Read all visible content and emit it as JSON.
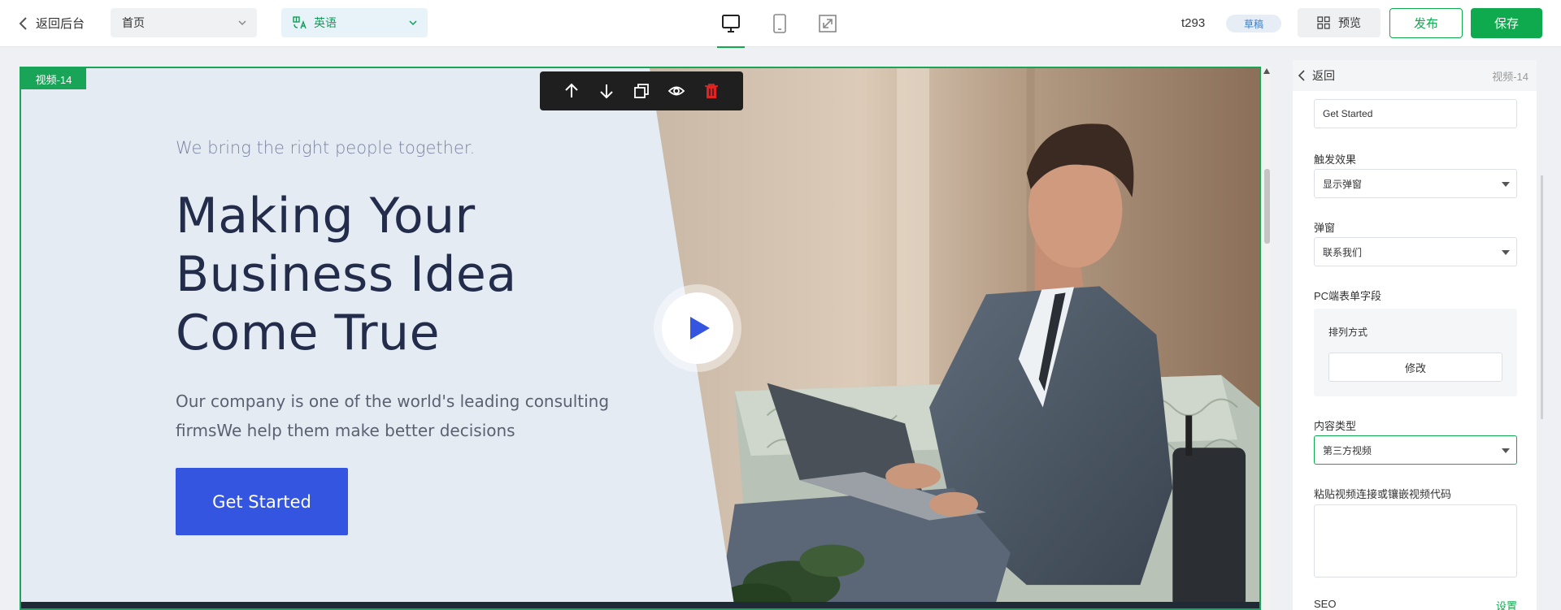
{
  "topbar": {
    "back_label": "返回后台",
    "page_select_value": "首页",
    "lang_select_value": "英语",
    "site_name": "t293",
    "status_badge": "草稿",
    "preview_label": "预览",
    "publish_label": "发布",
    "save_label": "保存"
  },
  "canvas": {
    "section_tag": "视频-14",
    "hero": {
      "tagline": "We bring the right people together.",
      "headline_lines": [
        "Making Your",
        "Business Idea",
        "Come True"
      ],
      "description": "Our company is one of the world's leading consulting firmsWe help them make better decisions",
      "cta_label": "Get Started"
    }
  },
  "panel": {
    "back_label": "返回",
    "title": "视频-14",
    "button_text_value": "Get Started",
    "trigger_label": "触发效果",
    "trigger_value": "显示弹窗",
    "popup_label": "弹窗",
    "popup_value": "联系我们",
    "pc_form_label": "PC端表单字段",
    "arrange_label": "排列方式",
    "modify_label": "修改",
    "content_type_label": "内容类型",
    "content_type_value": "第三方视频",
    "video_code_label": "粘贴视频连接或镶嵌视频代码",
    "seo_label": "SEO",
    "seo_link": "设置"
  },
  "colors": {
    "brand_green": "#0fa94e",
    "hero_blue": "#3355e0",
    "hero_bg": "#e4ebf3"
  }
}
